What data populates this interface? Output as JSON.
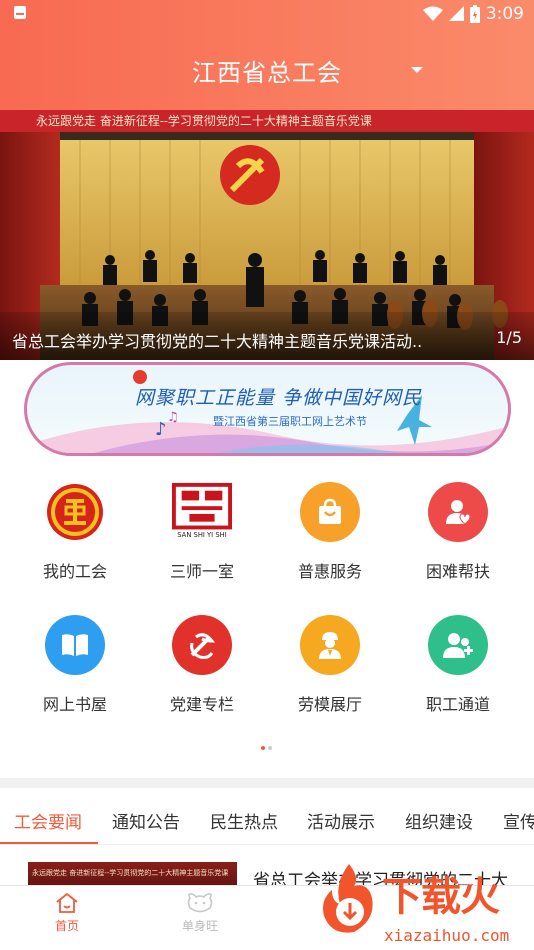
{
  "status": {
    "time": "3:09"
  },
  "header": {
    "title": "江西省总工会"
  },
  "banner": {
    "caption": "省总工会举办学习贯彻党的二十大精神主题音乐党课活动..",
    "counter": "1/5",
    "slogan": "永远跟党走 奋进新征程--学习贯彻党的二十大精神主题音乐党课"
  },
  "promo": {
    "line1": "网聚职工正能量 争做中国好网民",
    "line2": "暨江西省第三届职工网上艺术节"
  },
  "services": [
    {
      "label": "我的工会",
      "icon": "union-emblem-icon"
    },
    {
      "label": "三师一室",
      "icon": "sanshi-yishi-logo-icon"
    },
    {
      "label": "普惠服务",
      "icon": "shopping-bag-icon"
    },
    {
      "label": "困难帮扶",
      "icon": "helping-hand-icon"
    },
    {
      "label": "网上书屋",
      "icon": "book-icon"
    },
    {
      "label": "党建专栏",
      "icon": "party-emblem-icon"
    },
    {
      "label": "劳模展厅",
      "icon": "model-worker-icon"
    },
    {
      "label": "职工通道",
      "icon": "worker-channel-icon"
    }
  ],
  "sanshi_logo_text": "SAN SHI YI SHI",
  "tabs": [
    "工会要闻",
    "通知公告",
    "民生热点",
    "活动展示",
    "组织建设",
    "宣传"
  ],
  "news": {
    "thumb_text": "永远跟党走 奋进新征程--学习贯彻党的二十大精神主题音乐党课",
    "title": "省总工会举办学习贯彻党的二十大"
  },
  "bottom_nav": [
    {
      "label": "首页",
      "icon": "home-icon"
    },
    {
      "label": "单身旺",
      "icon": "single-icon"
    }
  ],
  "watermark": {
    "brand": "下载火",
    "url": "xiazaihuo.com"
  },
  "colors": {
    "accent": "#f25a3c",
    "header_start": "#f86a52",
    "header_end": "#fa8b6a"
  }
}
